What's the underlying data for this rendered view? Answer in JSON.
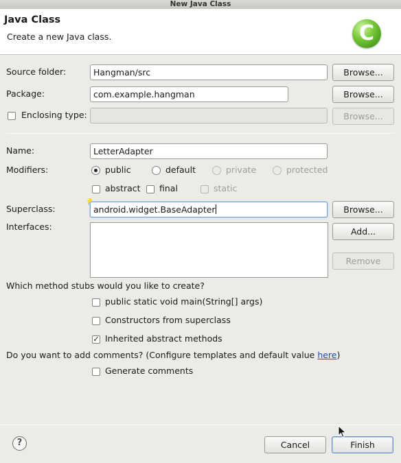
{
  "window": {
    "title": "New Java Class"
  },
  "banner": {
    "title": "Java Class",
    "description": "Create a new Java class.",
    "icon": "java-class-icon"
  },
  "source_folder": {
    "label": "Source folder:",
    "value": "Hangman/src",
    "browse": "Browse..."
  },
  "package": {
    "label": "Package:",
    "value": "com.example.hangman",
    "browse": "Browse..."
  },
  "enclosing": {
    "label": "Enclosing type:",
    "value": "",
    "browse": "Browse...",
    "checked": false
  },
  "name": {
    "label": "Name:",
    "value": "LetterAdapter"
  },
  "modifiers": {
    "label": "Modifiers:",
    "public": "public",
    "default": "default",
    "private": "private",
    "protected": "protected",
    "selected": "public",
    "abstract": "abstract",
    "final": "final",
    "static": "static"
  },
  "superclass": {
    "label": "Superclass:",
    "value": "android.widget.BaseAdapter",
    "browse": "Browse..."
  },
  "interfaces": {
    "label": "Interfaces:",
    "add": "Add...",
    "remove": "Remove",
    "items": []
  },
  "stubs": {
    "question": "Which method stubs would you like to create?",
    "main": {
      "label": "public static void main(String[] args)",
      "checked": false
    },
    "constructors": {
      "label": "Constructors from superclass",
      "checked": false
    },
    "inherited": {
      "label": "Inherited abstract methods",
      "checked": true
    }
  },
  "comments": {
    "question": "Do you want to add comments? (Configure templates and default value ",
    "link": "here",
    "close": ")",
    "generate": {
      "label": "Generate comments",
      "checked": false
    }
  },
  "footer": {
    "cancel": "Cancel",
    "finish": "Finish",
    "help_icon": "help-icon"
  },
  "colors": {
    "accent": "#6a8fc3",
    "link": "#1c4fa6",
    "icon_green": "#5aaa25"
  }
}
